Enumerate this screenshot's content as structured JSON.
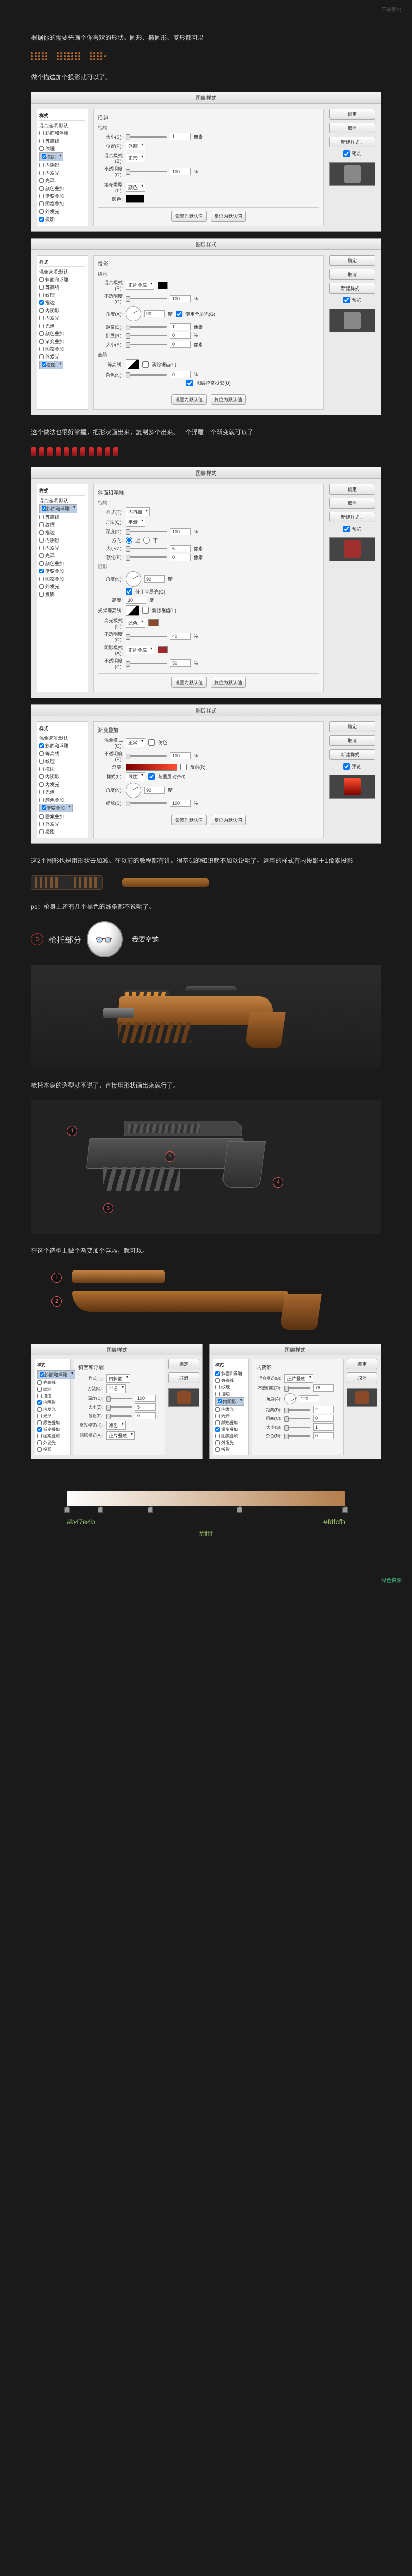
{
  "watermark": {
    "top": "三联素材",
    "bottom": "绿色资源"
  },
  "text": {
    "t1": "根据你的需要先画个你喜欢的形状。圆形、椭圆形、菱形都可以",
    "t2": "做个描边加个投影就可以了。",
    "t3": "这个做法也很好掌握，把形状画出来，复制多个出来。一个浮雕一个渐变就可以了",
    "t4": "这2个图形也是用形状去加减。在以前的教程都有讲，很基础的知识就不加以说明了。运用的样式有内投影＋1像素投影",
    "t5": "ps：枪身上还有几个黑色的线条都不说明了。",
    "t6": "枪托部分",
    "t7": "枪托本身的造型就不说了，直接用形状画出来就行了。",
    "t8": "在这个造型上做个渐变加个浮雕，就可以。",
    "speech": "我要空饷"
  },
  "steps": {
    "s3": "3",
    "c1": "1",
    "c2": "2",
    "c3": "3",
    "c4": "4",
    "p1": "1",
    "p2": "2"
  },
  "dialog": {
    "title": "图层样式",
    "side_header": "样式",
    "options": [
      "混合选项:默认",
      "斜面和浮雕",
      "等高线",
      "纹理",
      "描边",
      "内阴影",
      "内发光",
      "光泽",
      "颜色叠加",
      "渐变叠加",
      "图案叠加",
      "外发光",
      "投影"
    ],
    "btn_ok": "确定",
    "btn_cancel": "取消",
    "btn_new": "新建样式...",
    "chk_preview": "预览",
    "footer_default": "设置为默认值",
    "footer_reset": "复位为默认值",
    "stroke": {
      "title": "描边",
      "struct": "结构",
      "size": "大小(S):",
      "size_v": "1",
      "px": "像素",
      "pos": "位置(P):",
      "pos_v": "外部",
      "blend": "混合模式(B):",
      "blend_v": "正常",
      "opacity": "不透明度(O):",
      "opacity_v": "100",
      "pct": "%",
      "filltype": "填充类型(F):",
      "filltype_v": "颜色",
      "color": "颜色:"
    },
    "shadow": {
      "title": "投影",
      "blend": "混合模式(B):",
      "blend_v": "正片叠底",
      "opacity": "不透明度(O):",
      "opacity_v": "100",
      "angle": "角度(A):",
      "angle_v": "90",
      "deg": "度",
      "global": "使用全局光(G)",
      "distance": "距离(D):",
      "distance_v": "1",
      "spread": "扩展(R):",
      "spread_v": "0",
      "size": "大小(S):",
      "size_v": "0",
      "quality": "品质",
      "contour": "等高线:",
      "anti": "消除锯齿(L)",
      "noise": "杂色(N):",
      "noise_v": "0",
      "knockout": "图层挖空投影(U)"
    },
    "bevel": {
      "title": "斜面和浮雕",
      "struct": "结构",
      "style": "样式(T):",
      "style_v": "内斜面",
      "method": "方法(Q):",
      "method_v": "平滑",
      "depth": "深度(D):",
      "depth_v": "100",
      "dir": "方向:",
      "up": "上",
      "down": "下",
      "size": "大小(Z):",
      "size_v": "5",
      "soft": "软化(F):",
      "soft_v": "0",
      "shade": "阴影",
      "angle": "角度(N):",
      "angle_v": "90",
      "global": "使用全局光(G)",
      "alt": "高度:",
      "alt_v": "30",
      "gloss": "光泽等高线:",
      "anti": "消除锯齿(L)",
      "hmode": "高光模式(H):",
      "hmode_v": "滤色",
      "hopacity": "不透明度(O):",
      "hopacity_v": "40",
      "smode": "阴影模式(A):",
      "smode_v": "正片叠底",
      "sopacity": "不透明度(C):",
      "sopacity_v": "50"
    },
    "gradient": {
      "title": "渐变叠加",
      "blend": "混合模式(O):",
      "blend_v": "正常",
      "dither": "仿色",
      "opacity": "不透明度(P):",
      "opacity_v": "100",
      "grad": "渐变:",
      "reverse": "反向(R)",
      "style": "样式(L):",
      "style_v": "线性",
      "align": "与图层对齐(I)",
      "angle": "角度(N):",
      "angle_v": "90",
      "scale": "缩放(S):",
      "scale_v": "100"
    },
    "inner": {
      "title": "内阴影",
      "blend_v": "正片叠底",
      "opacity_v": "75",
      "angle_v": "120",
      "dist_v": "2",
      "choke": "阻塞(C):",
      "choke_v": "0",
      "size_v": "1",
      "noise_v": "0"
    }
  },
  "grad": {
    "left_hex": "#b47e4b",
    "right_hex": "#fdfcfb",
    "mid_hex": "#fffff"
  }
}
